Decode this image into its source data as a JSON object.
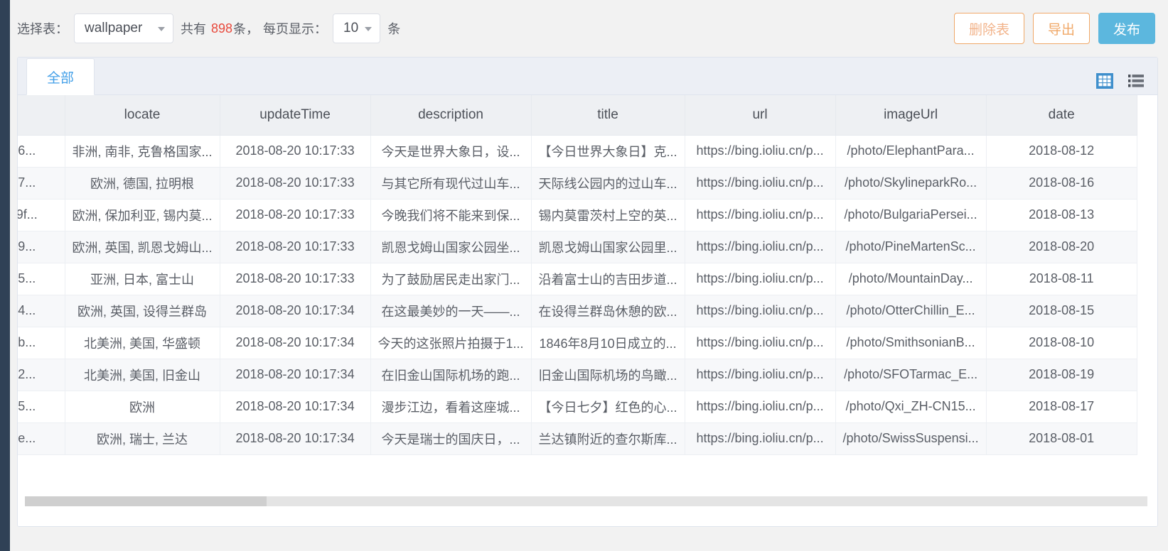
{
  "toolbar": {
    "select_table_label": "选择表：",
    "table_value": "wallpaper",
    "total_prefix": "共有",
    "total_count": "898",
    "total_suffix": "条，",
    "page_size_label": "每页显示：",
    "page_size_value": "10",
    "page_size_unit": "条",
    "buttons": {
      "delete_table": "删除表",
      "export": "导出",
      "publish": "发布"
    },
    "colors": {
      "count_red": "#e8493c",
      "warn_border": "#f0a868",
      "primary": "#5cb7de"
    }
  },
  "panel": {
    "tabs": [
      {
        "label": "全部",
        "active": true
      }
    ],
    "view_toggle": [
      {
        "name": "grid-view-icon",
        "active": true
      },
      {
        "name": "list-view-icon",
        "active": false
      }
    ]
  },
  "table": {
    "columns": [
      "",
      "locate",
      "updateTime",
      "description",
      "title",
      "url",
      "imageUrl",
      "date"
    ],
    "rows": [
      {
        "id": "6...",
        "locate": "非洲, 南非, 克鲁格国家...",
        "updateTime": "2018-08-20 10:17:33",
        "description": "今天是世界大象日，设...",
        "title": "【今日世界大象日】克...",
        "url": "https://bing.ioliu.cn/p...",
        "imageUrl": "/photo/ElephantPara...",
        "date": "2018-08-12"
      },
      {
        "id": "7...",
        "locate": "欧洲, 德国, 拉明根",
        "updateTime": "2018-08-20 10:17:33",
        "description": "与其它所有现代过山车...",
        "title": "天际线公园内的过山车...",
        "url": "https://bing.ioliu.cn/p...",
        "imageUrl": "/photo/SkylineparkRo...",
        "date": "2018-08-16"
      },
      {
        "id": "9f...",
        "locate": "欧洲, 保加利亚, 锡内莫...",
        "updateTime": "2018-08-20 10:17:33",
        "description": "今晚我们将不能来到保...",
        "title": "锡内莫雷茨村上空的英...",
        "url": "https://bing.ioliu.cn/p...",
        "imageUrl": "/photo/BulgariaPersei...",
        "date": "2018-08-13"
      },
      {
        "id": "9...",
        "locate": "欧洲, 英国, 凯恩戈姆山...",
        "updateTime": "2018-08-20 10:17:33",
        "description": "凯恩戈姆山国家公园坐...",
        "title": "凯恩戈姆山国家公园里...",
        "url": "https://bing.ioliu.cn/p...",
        "imageUrl": "/photo/PineMartenSc...",
        "date": "2018-08-20"
      },
      {
        "id": "5...",
        "locate": "亚洲, 日本, 富士山",
        "updateTime": "2018-08-20 10:17:33",
        "description": "为了鼓励居民走出家门...",
        "title": "沿着富士山的吉田步道...",
        "url": "https://bing.ioliu.cn/p...",
        "imageUrl": "/photo/MountainDay...",
        "date": "2018-08-11"
      },
      {
        "id": "4...",
        "locate": "欧洲, 英国, 设得兰群岛",
        "updateTime": "2018-08-20 10:17:34",
        "description": "在这最美妙的一天——...",
        "title": "在设得兰群岛休憩的欧...",
        "url": "https://bing.ioliu.cn/p...",
        "imageUrl": "/photo/OtterChillin_E...",
        "date": "2018-08-15"
      },
      {
        "id": "b...",
        "locate": "北美洲, 美国, 华盛顿",
        "updateTime": "2018-08-20 10:17:34",
        "description": "今天的这张照片拍摄于1...",
        "title": "1846年8月10日成立的...",
        "url": "https://bing.ioliu.cn/p...",
        "imageUrl": "/photo/SmithsonianB...",
        "date": "2018-08-10"
      },
      {
        "id": "2...",
        "locate": "北美洲, 美国, 旧金山",
        "updateTime": "2018-08-20 10:17:34",
        "description": "在旧金山国际机场的跑...",
        "title": "旧金山国际机场的鸟瞰...",
        "url": "https://bing.ioliu.cn/p...",
        "imageUrl": "/photo/SFOTarmac_E...",
        "date": "2018-08-19"
      },
      {
        "id": "5...",
        "locate": "欧洲",
        "updateTime": "2018-08-20 10:17:34",
        "description": "漫步江边，看着这座城...",
        "title": "【今日七夕】红色的心...",
        "url": "https://bing.ioliu.cn/p...",
        "imageUrl": "/photo/Qxi_ZH-CN15...",
        "date": "2018-08-17"
      },
      {
        "id": "e...",
        "locate": "欧洲, 瑞士, 兰达",
        "updateTime": "2018-08-20 10:17:34",
        "description": "今天是瑞士的国庆日，...",
        "title": "兰达镇附近的查尔斯库...",
        "url": "https://bing.ioliu.cn/p...",
        "imageUrl": "/photo/SwissSuspensi...",
        "date": "2018-08-01"
      }
    ]
  }
}
